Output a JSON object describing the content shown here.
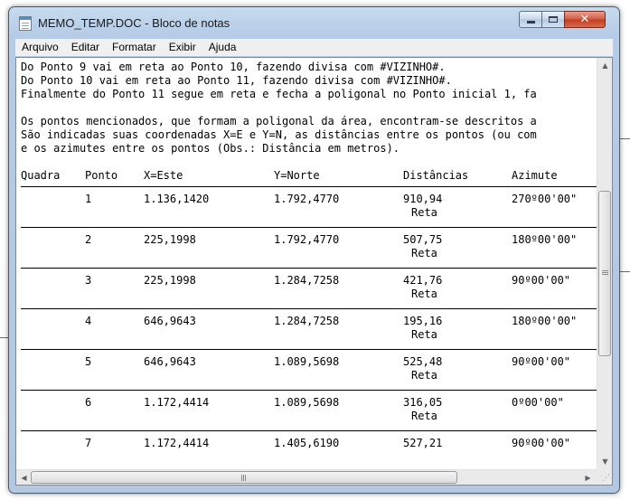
{
  "window": {
    "title": "MEMO_TEMP.DOC - Bloco de notas",
    "minimize_icon": "minimize-icon",
    "maximize_icon": "maximize-icon",
    "close_icon": "close-icon",
    "close_glyph": "✕"
  },
  "menu": [
    {
      "label": "Arquivo"
    },
    {
      "label": "Editar"
    },
    {
      "label": "Formatar"
    },
    {
      "label": "Exibir"
    },
    {
      "label": "Ajuda"
    }
  ],
  "text_lines": [
    "Do Ponto 9 vai em reta ao Ponto 10, fazendo divisa com #VIZINHO#.",
    "Do Ponto 10 vai em reta ao Ponto 11, fazendo divisa com #VIZINHO#.",
    "Finalmente do Ponto 11 segue em reta e fecha a poligonal no Ponto inicial 1, fa",
    "",
    "Os pontos mencionados, que formam a poligonal da área, encontram-se descritos a",
    "São indicadas suas coordenadas X=E e Y=N, as distâncias entre os pontos (ou com",
    "e os azimutes entre os pontos (Obs.: Distância em metros)."
  ],
  "table": {
    "headers": [
      "Quadra",
      "Ponto",
      "X=Este",
      "Y=Norte",
      "Distâncias",
      "Azimute"
    ],
    "rows": [
      {
        "quadra": "",
        "ponto": "1",
        "x": "1.136,1420",
        "y": "1.792,4770",
        "dist": "910,94",
        "tipo": "Reta",
        "azimute": "270º00'00\""
      },
      {
        "quadra": "",
        "ponto": "2",
        "x": "225,1998",
        "y": "1.792,4770",
        "dist": "507,75",
        "tipo": "Reta",
        "azimute": "180º00'00\""
      },
      {
        "quadra": "",
        "ponto": "3",
        "x": "225,1998",
        "y": "1.284,7258",
        "dist": "421,76",
        "tipo": "Reta",
        "azimute": "90º00'00\""
      },
      {
        "quadra": "",
        "ponto": "4",
        "x": "646,9643",
        "y": "1.284,7258",
        "dist": "195,16",
        "tipo": "Reta",
        "azimute": "180º00'00\""
      },
      {
        "quadra": "",
        "ponto": "5",
        "x": "646,9643",
        "y": "1.089,5698",
        "dist": "525,48",
        "tipo": "Reta",
        "azimute": "90º00'00\""
      },
      {
        "quadra": "",
        "ponto": "6",
        "x": "1.172,4414",
        "y": "1.089,5698",
        "dist": "316,05",
        "tipo": "Reta",
        "azimute": "0º00'00\""
      },
      {
        "quadra": "",
        "ponto": "7",
        "x": "1.172,4414",
        "y": "1.405,6190",
        "dist": "527,21",
        "tipo": "",
        "azimute": "90º00'00\""
      }
    ]
  },
  "scrollbars": {
    "up_icon": "scroll-up-icon",
    "down_icon": "scroll-down-icon",
    "left_icon": "scroll-left-icon",
    "right_icon": "scroll-right-icon"
  }
}
